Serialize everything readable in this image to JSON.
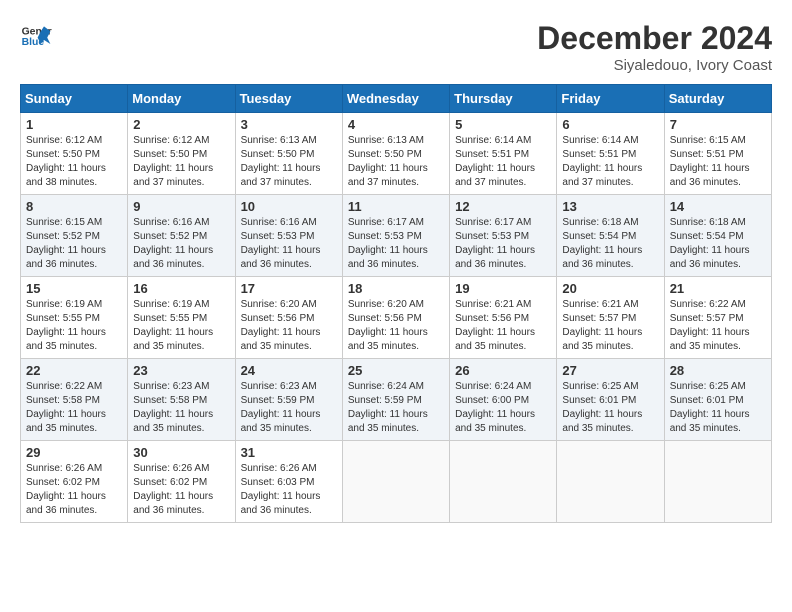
{
  "header": {
    "logo_line1": "General",
    "logo_line2": "Blue",
    "title": "December 2024",
    "subtitle": "Siyaledouo, Ivory Coast"
  },
  "weekdays": [
    "Sunday",
    "Monday",
    "Tuesday",
    "Wednesday",
    "Thursday",
    "Friday",
    "Saturday"
  ],
  "weeks": [
    [
      {
        "day": "1",
        "info": "Sunrise: 6:12 AM\nSunset: 5:50 PM\nDaylight: 11 hours\nand 38 minutes."
      },
      {
        "day": "2",
        "info": "Sunrise: 6:12 AM\nSunset: 5:50 PM\nDaylight: 11 hours\nand 37 minutes."
      },
      {
        "day": "3",
        "info": "Sunrise: 6:13 AM\nSunset: 5:50 PM\nDaylight: 11 hours\nand 37 minutes."
      },
      {
        "day": "4",
        "info": "Sunrise: 6:13 AM\nSunset: 5:50 PM\nDaylight: 11 hours\nand 37 minutes."
      },
      {
        "day": "5",
        "info": "Sunrise: 6:14 AM\nSunset: 5:51 PM\nDaylight: 11 hours\nand 37 minutes."
      },
      {
        "day": "6",
        "info": "Sunrise: 6:14 AM\nSunset: 5:51 PM\nDaylight: 11 hours\nand 37 minutes."
      },
      {
        "day": "7",
        "info": "Sunrise: 6:15 AM\nSunset: 5:51 PM\nDaylight: 11 hours\nand 36 minutes."
      }
    ],
    [
      {
        "day": "8",
        "info": "Sunrise: 6:15 AM\nSunset: 5:52 PM\nDaylight: 11 hours\nand 36 minutes."
      },
      {
        "day": "9",
        "info": "Sunrise: 6:16 AM\nSunset: 5:52 PM\nDaylight: 11 hours\nand 36 minutes."
      },
      {
        "day": "10",
        "info": "Sunrise: 6:16 AM\nSunset: 5:53 PM\nDaylight: 11 hours\nand 36 minutes."
      },
      {
        "day": "11",
        "info": "Sunrise: 6:17 AM\nSunset: 5:53 PM\nDaylight: 11 hours\nand 36 minutes."
      },
      {
        "day": "12",
        "info": "Sunrise: 6:17 AM\nSunset: 5:53 PM\nDaylight: 11 hours\nand 36 minutes."
      },
      {
        "day": "13",
        "info": "Sunrise: 6:18 AM\nSunset: 5:54 PM\nDaylight: 11 hours\nand 36 minutes."
      },
      {
        "day": "14",
        "info": "Sunrise: 6:18 AM\nSunset: 5:54 PM\nDaylight: 11 hours\nand 36 minutes."
      }
    ],
    [
      {
        "day": "15",
        "info": "Sunrise: 6:19 AM\nSunset: 5:55 PM\nDaylight: 11 hours\nand 35 minutes."
      },
      {
        "day": "16",
        "info": "Sunrise: 6:19 AM\nSunset: 5:55 PM\nDaylight: 11 hours\nand 35 minutes."
      },
      {
        "day": "17",
        "info": "Sunrise: 6:20 AM\nSunset: 5:56 PM\nDaylight: 11 hours\nand 35 minutes."
      },
      {
        "day": "18",
        "info": "Sunrise: 6:20 AM\nSunset: 5:56 PM\nDaylight: 11 hours\nand 35 minutes."
      },
      {
        "day": "19",
        "info": "Sunrise: 6:21 AM\nSunset: 5:56 PM\nDaylight: 11 hours\nand 35 minutes."
      },
      {
        "day": "20",
        "info": "Sunrise: 6:21 AM\nSunset: 5:57 PM\nDaylight: 11 hours\nand 35 minutes."
      },
      {
        "day": "21",
        "info": "Sunrise: 6:22 AM\nSunset: 5:57 PM\nDaylight: 11 hours\nand 35 minutes."
      }
    ],
    [
      {
        "day": "22",
        "info": "Sunrise: 6:22 AM\nSunset: 5:58 PM\nDaylight: 11 hours\nand 35 minutes."
      },
      {
        "day": "23",
        "info": "Sunrise: 6:23 AM\nSunset: 5:58 PM\nDaylight: 11 hours\nand 35 minutes."
      },
      {
        "day": "24",
        "info": "Sunrise: 6:23 AM\nSunset: 5:59 PM\nDaylight: 11 hours\nand 35 minutes."
      },
      {
        "day": "25",
        "info": "Sunrise: 6:24 AM\nSunset: 5:59 PM\nDaylight: 11 hours\nand 35 minutes."
      },
      {
        "day": "26",
        "info": "Sunrise: 6:24 AM\nSunset: 6:00 PM\nDaylight: 11 hours\nand 35 minutes."
      },
      {
        "day": "27",
        "info": "Sunrise: 6:25 AM\nSunset: 6:01 PM\nDaylight: 11 hours\nand 35 minutes."
      },
      {
        "day": "28",
        "info": "Sunrise: 6:25 AM\nSunset: 6:01 PM\nDaylight: 11 hours\nand 35 minutes."
      }
    ],
    [
      {
        "day": "29",
        "info": "Sunrise: 6:26 AM\nSunset: 6:02 PM\nDaylight: 11 hours\nand 36 minutes."
      },
      {
        "day": "30",
        "info": "Sunrise: 6:26 AM\nSunset: 6:02 PM\nDaylight: 11 hours\nand 36 minutes."
      },
      {
        "day": "31",
        "info": "Sunrise: 6:26 AM\nSunset: 6:03 PM\nDaylight: 11 hours\nand 36 minutes."
      },
      {
        "day": "",
        "info": ""
      },
      {
        "day": "",
        "info": ""
      },
      {
        "day": "",
        "info": ""
      },
      {
        "day": "",
        "info": ""
      }
    ]
  ]
}
